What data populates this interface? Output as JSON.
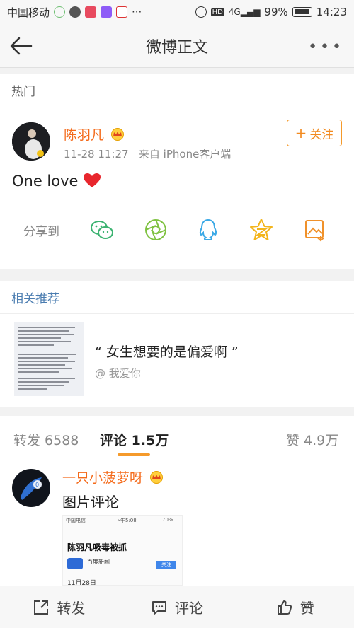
{
  "statusbar": {
    "carrier": "中国移动",
    "battery": "99%",
    "time": "14:23"
  },
  "navbar": {
    "title": "微博正文"
  },
  "hot_label": "热门",
  "post": {
    "author": "陈羽凡",
    "follow_label": "关注",
    "time": "11-28 11:27",
    "source": "来自 iPhone客户端",
    "content": "One love",
    "share_label": "分享到"
  },
  "related": {
    "label": "相关推荐",
    "item_title": "“ 女生想要的是偏爱啊 ”",
    "item_author": "@ 我爱你"
  },
  "tabs": [
    {
      "label": "转发 6588"
    },
    {
      "label": "评论 1.5万"
    },
    {
      "label": "赞 4.9万"
    }
  ],
  "comment": {
    "author": "一只小菠萝呀",
    "text": "图片评论",
    "image_headline": "陈羽凡吸毒被抓",
    "image_source": "百度新闻",
    "image_button": "关注",
    "image_status_time": "下午5:08",
    "image_status_battery": "70%",
    "image_status_carrier": "中国电信",
    "image_date": "11月28日"
  },
  "bottom": {
    "repost": "转发",
    "comment": "评论",
    "like": "赞"
  },
  "colors": {
    "accent": "#f46a1a",
    "link": "#4a7cb0"
  }
}
